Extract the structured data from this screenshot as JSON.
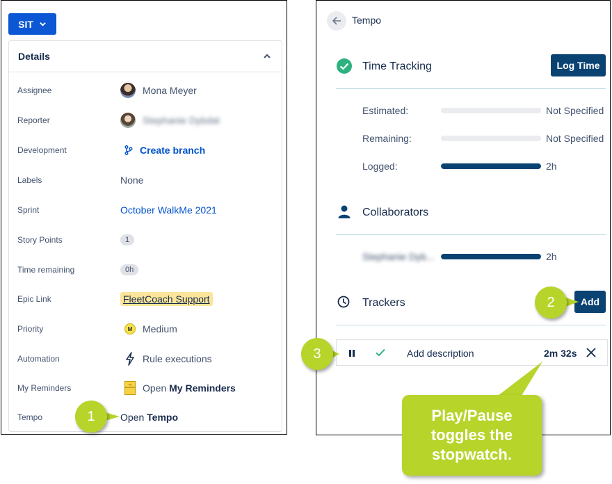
{
  "left": {
    "sit_label": "SIT",
    "details_title": "Details",
    "rows": [
      {
        "label": "Assignee",
        "value": "Mona Meyer"
      },
      {
        "label": "Reporter",
        "value": "Stephanie Dybdal"
      },
      {
        "label": "Development",
        "value": "Create branch"
      },
      {
        "label": "Labels",
        "value": "None"
      },
      {
        "label": "Sprint",
        "value": "October WalkMe 2021"
      },
      {
        "label": "Story Points",
        "value": "1"
      },
      {
        "label": "Time remaining",
        "value": "0h"
      },
      {
        "label": "Epic Link",
        "value": "FleetCoach Support"
      },
      {
        "label": "Priority",
        "value": "Medium"
      },
      {
        "label": "Automation",
        "value": "Rule executions"
      },
      {
        "label": "My Reminders",
        "value_prefix": "Open ",
        "value_strong": "My Reminders"
      },
      {
        "label": "Tempo",
        "value_prefix": "Open ",
        "value_strong": "Tempo"
      }
    ],
    "reminder_icon_text": "My Reminders"
  },
  "right": {
    "title": "Tempo",
    "time_tracking": {
      "title": "Time Tracking",
      "log_time_label": "Log Time",
      "stats": [
        {
          "label": "Estimated:",
          "value": "Not Specified",
          "fill": 0
        },
        {
          "label": "Remaining:",
          "value": "Not Specified",
          "fill": 0
        },
        {
          "label": "Logged:",
          "value": "2h",
          "fill": 1
        }
      ]
    },
    "collaborators": {
      "title": "Collaborators",
      "items": [
        {
          "name": "Stephanie Dyb...",
          "value": "2h",
          "fill": 1
        }
      ]
    },
    "trackers": {
      "title": "Trackers",
      "add_label": "Add",
      "tracker": {
        "description": "Add description",
        "time": "2m 32s"
      }
    }
  },
  "callouts": {
    "one": "1",
    "two": "2",
    "three": "3",
    "note_line1": "Play/Pause",
    "note_line2": "toggles the",
    "note_line3": "stopwatch."
  },
  "colors": {
    "accent_blue": "#0c57d4",
    "tempo_dark": "#0a4272",
    "callout_green": "#b7d42a",
    "success_green": "#2db180"
  },
  "icons": [
    "chevron-down-icon",
    "chevron-up-icon",
    "branch-icon",
    "lightning-icon",
    "priority-medium-icon",
    "reminder-icon",
    "arrow-left-icon",
    "check-circle-icon",
    "person-icon",
    "clock-icon",
    "pause-icon",
    "check-icon",
    "close-icon"
  ]
}
